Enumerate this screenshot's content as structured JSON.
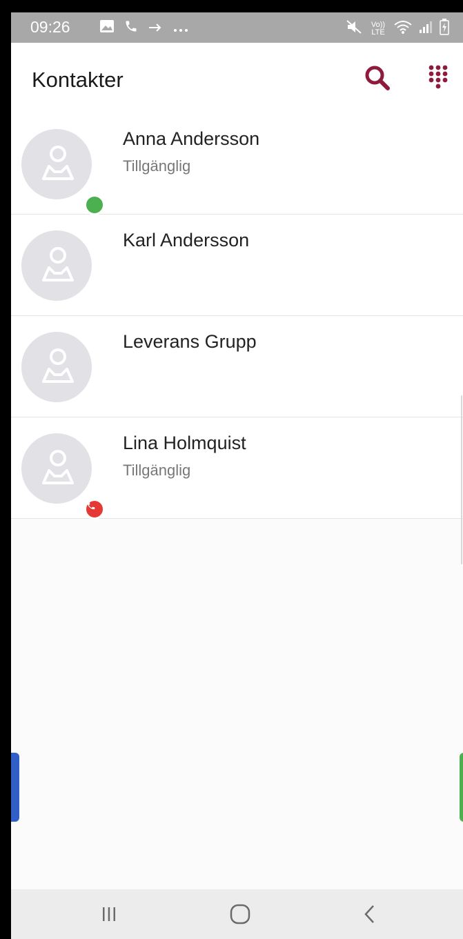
{
  "status_bar": {
    "time": "09:26",
    "left_icons": [
      "gallery-icon",
      "phone-icon",
      "forward-arrow-icon",
      "more-dots-icon"
    ],
    "right_icons": [
      "mute-icon",
      "volte-icon",
      "wifi-icon",
      "signal-icon",
      "battery-icon"
    ],
    "volte_label": "Vo)) LTE"
  },
  "header": {
    "title": "Kontakter",
    "accent_color": "#8e1b3b"
  },
  "contacts": [
    {
      "name": "Anna Andersson",
      "status": "Tillgänglig",
      "presence": "available",
      "presence_color": "#4caf50"
    },
    {
      "name": "Karl Andersson",
      "status": "",
      "presence": "none"
    },
    {
      "name": "Leverans Grupp",
      "status": "",
      "presence": "none"
    },
    {
      "name": "Lina Holmquist",
      "status": "Tillgänglig",
      "presence": "on-call",
      "presence_color": "#e53935"
    }
  ],
  "nav": {
    "buttons": [
      "recent-apps",
      "home",
      "back"
    ]
  }
}
